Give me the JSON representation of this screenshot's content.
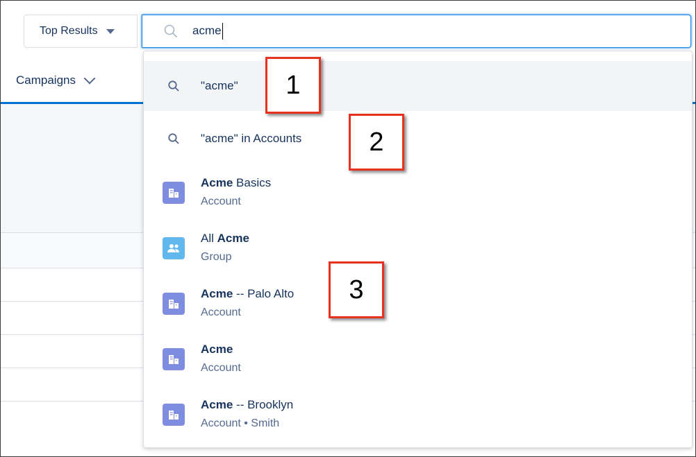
{
  "scope_selector": {
    "label": "Top Results"
  },
  "search": {
    "value": "acme"
  },
  "nav": {
    "campaigns_label": "Campaigns"
  },
  "dropdown": {
    "queries": [
      {
        "text": "\"acme\""
      },
      {
        "text": "\"acme\" in Accounts"
      }
    ],
    "records": [
      {
        "bold": "Acme",
        "rest": " Basics",
        "sub": "Account",
        "icon": "account-icon"
      },
      {
        "pre": "All ",
        "bold": "Acme",
        "rest": "",
        "sub": "Group",
        "icon": "group-icon"
      },
      {
        "bold": "Acme",
        "rest": " -- Palo Alto",
        "sub": "Account",
        "icon": "account-icon"
      },
      {
        "bold": "Acme",
        "rest": "",
        "sub": "Account",
        "icon": "account-icon"
      },
      {
        "bold": "Acme",
        "rest": " -- Brooklyn",
        "sub": "Account • Smith",
        "icon": "account-icon"
      }
    ]
  },
  "callouts": [
    "1",
    "2",
    "3"
  ],
  "colors": {
    "accent": "#0070d2",
    "account_icon": "#7f8de1",
    "group_icon": "#62b7ed",
    "callout_border": "#e8321f"
  }
}
